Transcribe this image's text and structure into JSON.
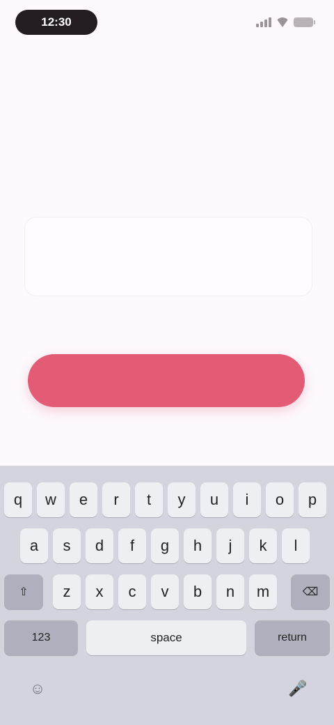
{
  "status_bar": {
    "time": "12:30",
    "icons": [
      "signal-icon",
      "wifi-icon",
      "battery-icon"
    ]
  },
  "content": {
    "title": "",
    "subtitle": ""
  },
  "input": {
    "placeholder": "",
    "value": ""
  },
  "primary_button": {
    "label": "",
    "color": "#e35b75"
  },
  "keyboard": {
    "row1": [
      "q",
      "w",
      "e",
      "r",
      "t",
      "y",
      "u",
      "i",
      "o",
      "p"
    ],
    "row2": [
      "a",
      "s",
      "d",
      "f",
      "g",
      "h",
      "j",
      "k",
      "l"
    ],
    "row3": [
      "z",
      "x",
      "c",
      "v",
      "b",
      "n",
      "m"
    ],
    "shift_icon": "shift-icon",
    "backspace_icon": "backspace-icon",
    "numbers_label": "123",
    "space_label": "space",
    "return_label": "return",
    "emoji_icon": "emoji-icon",
    "mic_icon": "microphone-icon"
  }
}
